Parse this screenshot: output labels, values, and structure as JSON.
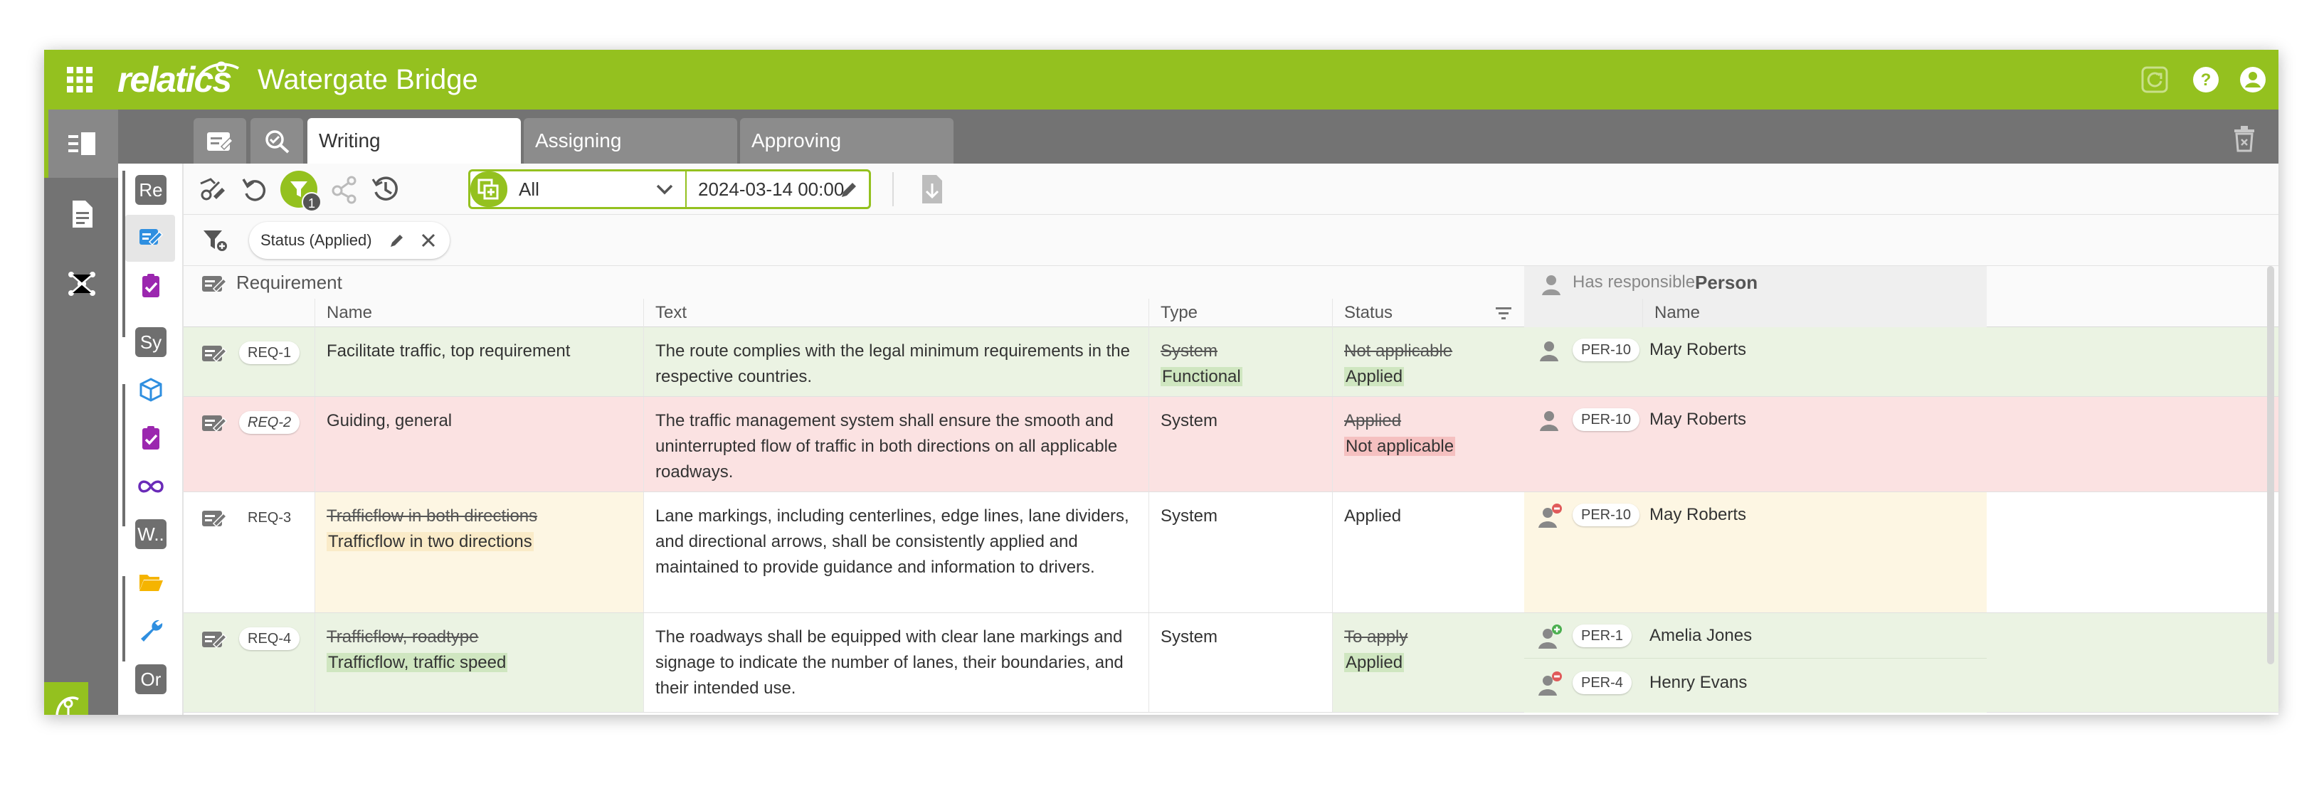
{
  "app": {
    "brand": "relatics",
    "title": "Watergate Bridge"
  },
  "tabs": [
    {
      "label": "Writing",
      "active": true
    },
    {
      "label": "Assigning",
      "active": false
    },
    {
      "label": "Approving",
      "active": false
    }
  ],
  "sidebar": {
    "badges": [
      "Re",
      "Sy",
      "W..",
      "Or"
    ]
  },
  "toolbar": {
    "filter_count": "1",
    "scope_value": "All",
    "date_value": "2024-03-14 00:00"
  },
  "filters": {
    "chip_label": "Status (Applied)"
  },
  "table": {
    "group_requirement": "Requirement",
    "group_person_prefix": "Has responsible",
    "group_person_name": "Person",
    "columns": [
      "Name",
      "Text",
      "Type",
      "Status"
    ],
    "person_column": "Name",
    "rows": [
      {
        "id": "REQ-1",
        "name_new": "Facilitate traffic, top requirement",
        "text": "The route complies with the legal minimum requirements in the respective countries.",
        "type_old": "System",
        "type_new": "Functional",
        "status_old": "Not applicable",
        "status_new": "Applied",
        "persons": [
          {
            "id": "PER-10",
            "name": "May Roberts"
          }
        ]
      },
      {
        "id": "REQ-2",
        "name_new": "Guiding, general",
        "text": "The traffic management system shall ensure the smooth and uninterrupted flow of traffic in both directions on all applicable roadways.",
        "type_new": "System",
        "status_old": "Applied",
        "status_new": "Not applicable",
        "persons": [
          {
            "id": "PER-10",
            "name": "May Roberts"
          }
        ]
      },
      {
        "id": "REQ-3",
        "name_old": "Trafficflow in both directions",
        "name_new": "Trafficflow in two directions",
        "text": "Lane markings, including centerlines, edge lines, lane dividers, and directional arrows, shall be consistently applied and maintained to provide guidance and information to drivers.",
        "type_new": "System",
        "status_new": "Applied",
        "persons": [
          {
            "id": "PER-10",
            "name": "May Roberts"
          }
        ]
      },
      {
        "id": "REQ-4",
        "name_old": "Trafficflow, roadtype",
        "name_new": "Trafficflow, traffic speed",
        "text": "The roadways shall be equipped with clear lane markings and signage to indicate the number of lanes, their boundaries, and their intended use.",
        "type_new": "System",
        "status_old": "To apply",
        "status_new": "Applied",
        "persons": [
          {
            "id": "PER-1",
            "name": "Amelia Jones"
          },
          {
            "id": "PER-4",
            "name": "Henry Evans"
          }
        ]
      }
    ]
  },
  "colors": {
    "brand_green": "#94c11f",
    "row_green": "#ebf3e3",
    "row_red": "#fbe2e2",
    "row_yellow": "#fdf6e3"
  }
}
